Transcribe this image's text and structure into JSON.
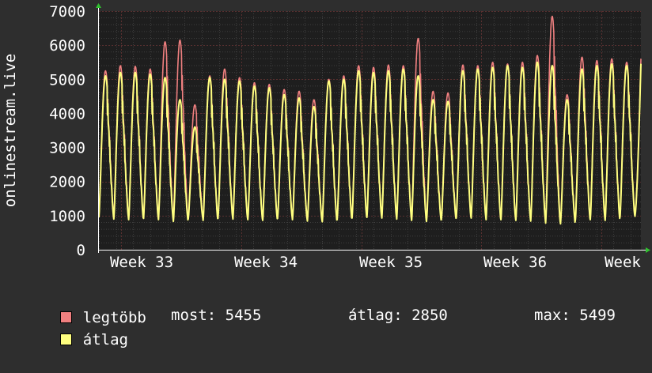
{
  "chart_data": {
    "type": "line",
    "ylabel": "onlinestream.live",
    "ylim": [
      0,
      7000
    ],
    "yticks": [
      0,
      1000,
      2000,
      3000,
      4000,
      5000,
      6000,
      7000
    ],
    "xticks": [
      "Week 33",
      "Week 34",
      "Week 35",
      "Week 36",
      "Week"
    ],
    "grid": true,
    "x_span_days": 31.6,
    "series": [
      {
        "name": "legtöbb",
        "color": "#f08080",
        "daily_peaks": [
          5250,
          5400,
          5380,
          5300,
          6100,
          6150,
          4250,
          5100,
          5300,
          5050,
          4900,
          4850,
          4700,
          4650,
          4400,
          5000,
          5100,
          5400,
          5350,
          5420,
          5400,
          6200,
          4650,
          4600,
          5420,
          5400,
          5500,
          5450,
          5500,
          5700,
          6850,
          4550,
          5650,
          5550,
          5600,
          5500
        ],
        "daily_mins": [
          1000,
          950,
          900,
          950,
          900,
          850,
          920,
          880,
          950,
          920,
          900,
          880,
          950,
          900,
          870,
          850,
          900,
          950,
          980,
          950,
          920,
          880,
          850,
          900,
          950,
          950,
          900,
          900,
          880,
          860,
          800,
          780,
          900,
          900,
          880,
          1000
        ],
        "end_value": 5600
      },
      {
        "name": "átlag",
        "color": "#ffff80",
        "daily_peaks": [
          5100,
          5200,
          5200,
          5150,
          5050,
          4400,
          3600,
          5050,
          5000,
          4950,
          4800,
          4750,
          4550,
          4450,
          4200,
          4950,
          5000,
          5250,
          5200,
          5250,
          5300,
          5100,
          4400,
          4350,
          5250,
          5300,
          5350,
          5400,
          5350,
          5500,
          5400,
          4400,
          5300,
          5400,
          5450,
          5400
        ],
        "daily_mins": [
          950,
          900,
          880,
          920,
          880,
          830,
          900,
          860,
          920,
          900,
          880,
          860,
          920,
          880,
          840,
          820,
          880,
          930,
          950,
          930,
          900,
          860,
          830,
          880,
          930,
          930,
          880,
          880,
          860,
          840,
          780,
          760,
          880,
          880,
          860,
          980
        ],
        "end_value": 5455
      }
    ]
  },
  "legend": {
    "max_label": "legtöbb",
    "avg_label": "átlag",
    "now_text": "most: 5455",
    "avg_text": "átlag: 2850",
    "max_text": "max: 5499"
  }
}
